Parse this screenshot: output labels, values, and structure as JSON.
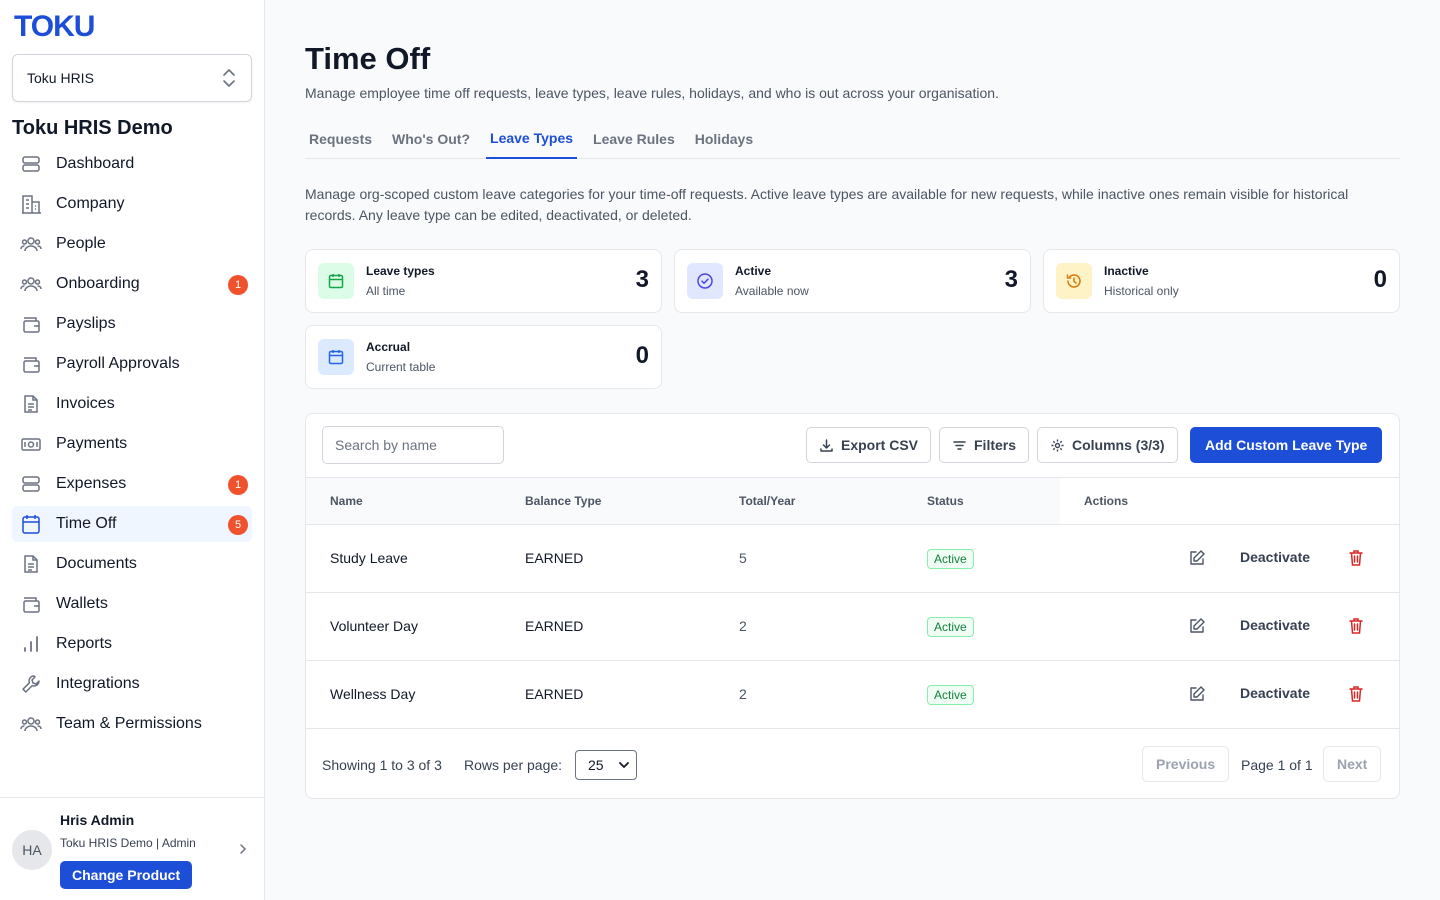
{
  "brand": {
    "logo": "TOKU",
    "accent": "#1d4ed8"
  },
  "product_selector": {
    "value": "Toku HRIS"
  },
  "org": {
    "name": "Toku HRIS Demo"
  },
  "sidebar": {
    "items": [
      {
        "label": "Dashboard",
        "icon": "dashboard-icon",
        "badge": ""
      },
      {
        "label": "Company",
        "icon": "building-icon",
        "badge": ""
      },
      {
        "label": "People",
        "icon": "people-icon",
        "badge": ""
      },
      {
        "label": "Onboarding",
        "icon": "onboarding-icon",
        "badge": "1"
      },
      {
        "label": "Payslips",
        "icon": "wallet-icon",
        "badge": ""
      },
      {
        "label": "Payroll Approvals",
        "icon": "wallet-icon",
        "badge": ""
      },
      {
        "label": "Invoices",
        "icon": "file-icon",
        "badge": ""
      },
      {
        "label": "Payments",
        "icon": "banknote-icon",
        "badge": ""
      },
      {
        "label": "Expenses",
        "icon": "expenses-icon",
        "badge": "1"
      },
      {
        "label": "Time Off",
        "icon": "calendar-icon",
        "badge": "5",
        "active": true
      },
      {
        "label": "Documents",
        "icon": "file-icon",
        "badge": ""
      },
      {
        "label": "Wallets",
        "icon": "wallet-icon",
        "badge": ""
      },
      {
        "label": "Reports",
        "icon": "bar-chart-icon",
        "badge": ""
      },
      {
        "label": "Integrations",
        "icon": "wrench-icon",
        "badge": ""
      },
      {
        "label": "Team & Permissions",
        "icon": "people-icon",
        "badge": ""
      }
    ]
  },
  "user": {
    "initials": "HA",
    "name": "Hris Admin",
    "role": "Toku HRIS Demo | Admin",
    "change_product_label": "Change Product"
  },
  "page": {
    "title": "Time Off",
    "subtitle": "Manage employee time off requests, leave types, leave rules, holidays, and who is out across your organisation.",
    "tabs": [
      {
        "label": "Requests",
        "active": false
      },
      {
        "label": "Who's Out?",
        "active": false
      },
      {
        "label": "Leave Types",
        "active": true
      },
      {
        "label": "Leave Rules",
        "active": false
      },
      {
        "label": "Holidays",
        "active": false
      }
    ],
    "description": "Manage org-scoped custom leave categories for your time-off requests. Active leave types are available for new requests, while inactive ones remain visible for historical records. Any leave type can be edited, deactivated, or deleted."
  },
  "stats": [
    {
      "label": "Leave types",
      "sub": "All time",
      "value": "3",
      "icon": "calendar-icon",
      "tint": "#dcfce7",
      "color": "#16a34a"
    },
    {
      "label": "Active",
      "sub": "Available now",
      "value": "3",
      "icon": "check-circle-icon",
      "tint": "#e0e7ff",
      "color": "#4f46e5"
    },
    {
      "label": "Inactive",
      "sub": "Historical only",
      "value": "0",
      "icon": "history-icon",
      "tint": "#fef3c7",
      "color": "#d97706"
    },
    {
      "label": "Accrual",
      "sub": "Current table",
      "value": "0",
      "icon": "calendar-icon",
      "tint": "#dbeafe",
      "color": "#2563eb"
    }
  ],
  "toolbar": {
    "search_placeholder": "Search by name",
    "export_label": "Export CSV",
    "filters_label": "Filters",
    "columns_label": "Columns (3/3)",
    "add_label": "Add Custom Leave Type"
  },
  "table": {
    "headers": [
      "Name",
      "Balance Type",
      "Total/Year",
      "Status",
      "Actions"
    ],
    "rows": [
      {
        "name": "Study Leave",
        "balance_type": "EARNED",
        "total": "5",
        "status": "Active",
        "action": "Deactivate"
      },
      {
        "name": "Volunteer Day",
        "balance_type": "EARNED",
        "total": "2",
        "status": "Active",
        "action": "Deactivate"
      },
      {
        "name": "Wellness Day",
        "balance_type": "EARNED",
        "total": "2",
        "status": "Active",
        "action": "Deactivate"
      }
    ]
  },
  "pagination": {
    "showing": "Showing 1 to 3 of 3",
    "rows_per_page_label": "Rows per page:",
    "rows_per_page": "25",
    "previous": "Previous",
    "page_info": "Page 1 of 1",
    "next": "Next"
  }
}
